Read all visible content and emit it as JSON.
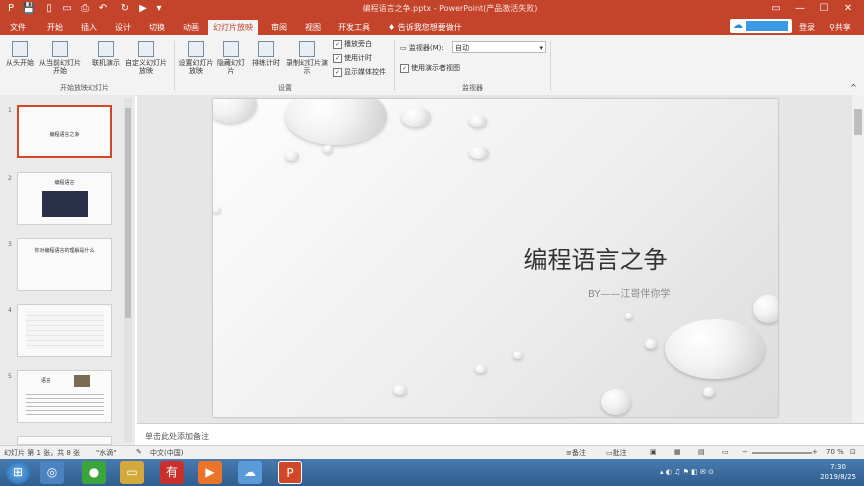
{
  "window": {
    "title": "编程语言之争.pptx - PowerPoint(产品激活失败)",
    "controls": [
      "▭",
      "—",
      "☐",
      "✕"
    ]
  },
  "tabs": [
    "文件",
    "开始",
    "插入",
    "设计",
    "切换",
    "动画",
    "幻灯片放映",
    "审阅",
    "视图",
    "开发工具",
    "告诉我您想要做什么..."
  ],
  "active_tab": "幻灯片放映",
  "account": {
    "login": "登录",
    "share": "共享"
  },
  "ribbon": {
    "start_group": {
      "buttons": [
        "从头开始",
        "从当前幻灯片开始",
        "联机演示",
        "自定义幻灯片放映"
      ],
      "label": "开始放映幻灯片"
    },
    "setup_group": {
      "buttons": [
        "设置幻灯片放映",
        "隐藏幻灯片",
        "排练计时",
        "录制幻灯片演示"
      ],
      "checks": [
        "播放旁白",
        "使用计时",
        "显示媒体控件"
      ],
      "label": "设置"
    },
    "monitor_group": {
      "monitor_label": "监视器(M):",
      "monitor_value": "自动",
      "presenter_view": "使用演示者视图",
      "label": "监视器"
    }
  },
  "thumbnails": [
    {
      "num": "1",
      "title": "编程语言之争"
    },
    {
      "num": "2",
      "title": "编程语言"
    },
    {
      "num": "3",
      "title": "你对编程语言的理解是什么"
    },
    {
      "num": "4",
      "title": ""
    },
    {
      "num": "5",
      "title": "语言"
    }
  ],
  "slide": {
    "title": "编程语言之争",
    "subtitle": "BY——江哥伴你学"
  },
  "notes_placeholder": "单击此处添加备注",
  "status": {
    "slide_info": "幻灯片 第 1 张，共 8 张",
    "theme": "\"水滴\"",
    "language": "中文(中国)",
    "notes_btn": "备注",
    "comments_btn": "批注",
    "zoom": "70 %"
  },
  "taskbar": {
    "time": "7:30",
    "date": "2019/8/25"
  },
  "colors": {
    "accent": "#c3432b",
    "taskbar": "#2f5d8e"
  }
}
